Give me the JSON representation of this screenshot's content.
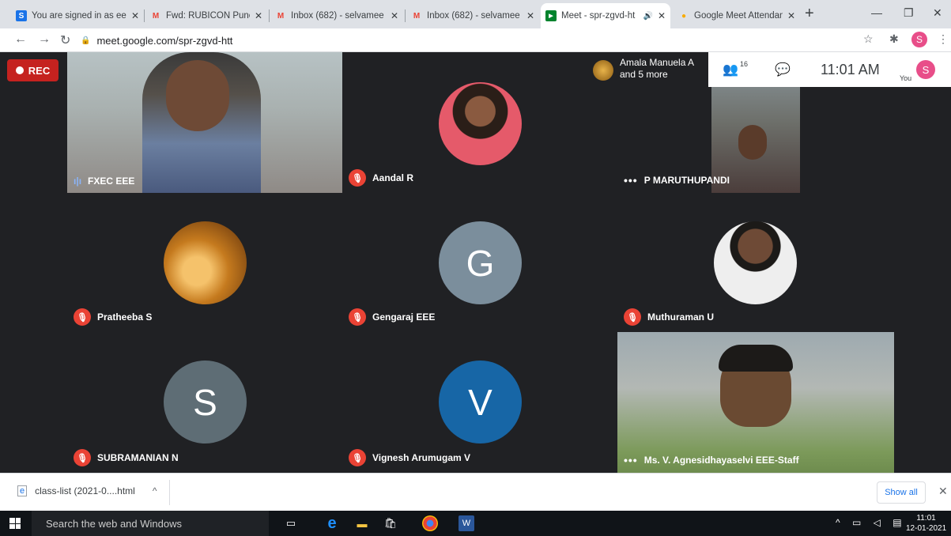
{
  "browser": {
    "tabs": [
      {
        "title": "You are signed in as ee",
        "favicon": "S",
        "favcolor": "#1a73e8"
      },
      {
        "title": "Fwd: RUBICON Pune RE",
        "favicon": "M",
        "favcolor": "#ea4335"
      },
      {
        "title": "Inbox (682) - selvamee",
        "favicon": "M",
        "favcolor": "#ea4335"
      },
      {
        "title": "Inbox (682) - selvamee",
        "favicon": "M",
        "favcolor": "#ea4335"
      },
      {
        "title": "Meet - spr-zgvd-ht",
        "favicon": "▶",
        "favcolor": "#00832d"
      },
      {
        "title": "Google Meet Attendan",
        "favicon": "●",
        "favcolor": "#f9ab00"
      }
    ],
    "url": "meet.google.com/spr-zgvd-htt",
    "profile_initial": "S"
  },
  "meet": {
    "rec_label": "REC",
    "presenter": {
      "line1": "Amala Manuela A",
      "line2": "and 5 more"
    },
    "participant_count": "16",
    "time": "11:01 AM",
    "you_label": "You",
    "self_initial": "S",
    "tiles": [
      {
        "name": "FXEC EEE",
        "status": "speaking",
        "kind": "video1"
      },
      {
        "name": "Aandal R",
        "status": "muted",
        "kind": "photo-woman"
      },
      {
        "name": "P MARUTHUPANDI",
        "status": "more",
        "kind": "video2"
      },
      {
        "name": "Pratheeba S",
        "status": "muted",
        "kind": "photo-hand"
      },
      {
        "name": "Gengaraj EEE",
        "status": "muted",
        "kind": "letter",
        "letter": "G",
        "color": "#7b8e9c"
      },
      {
        "name": "Muthuraman U",
        "status": "muted",
        "kind": "photo-man"
      },
      {
        "name": "SUBRAMANIAN N",
        "status": "muted",
        "kind": "letter",
        "letter": "S",
        "color": "#5e6d75"
      },
      {
        "name": "Vignesh Arumugam V",
        "status": "muted",
        "kind": "letter",
        "letter": "V",
        "color": "#1766a6"
      },
      {
        "name": "Ms. V. Agnesidhayaselvi EEE-Staff",
        "status": "more",
        "kind": "video3"
      }
    ]
  },
  "downloads": {
    "file": "class-list (2021-0....html",
    "show_all": "Show all"
  },
  "taskbar": {
    "search_placeholder": "Search the web and Windows",
    "clock_time": "11:01",
    "clock_date": "12-01-2021"
  }
}
